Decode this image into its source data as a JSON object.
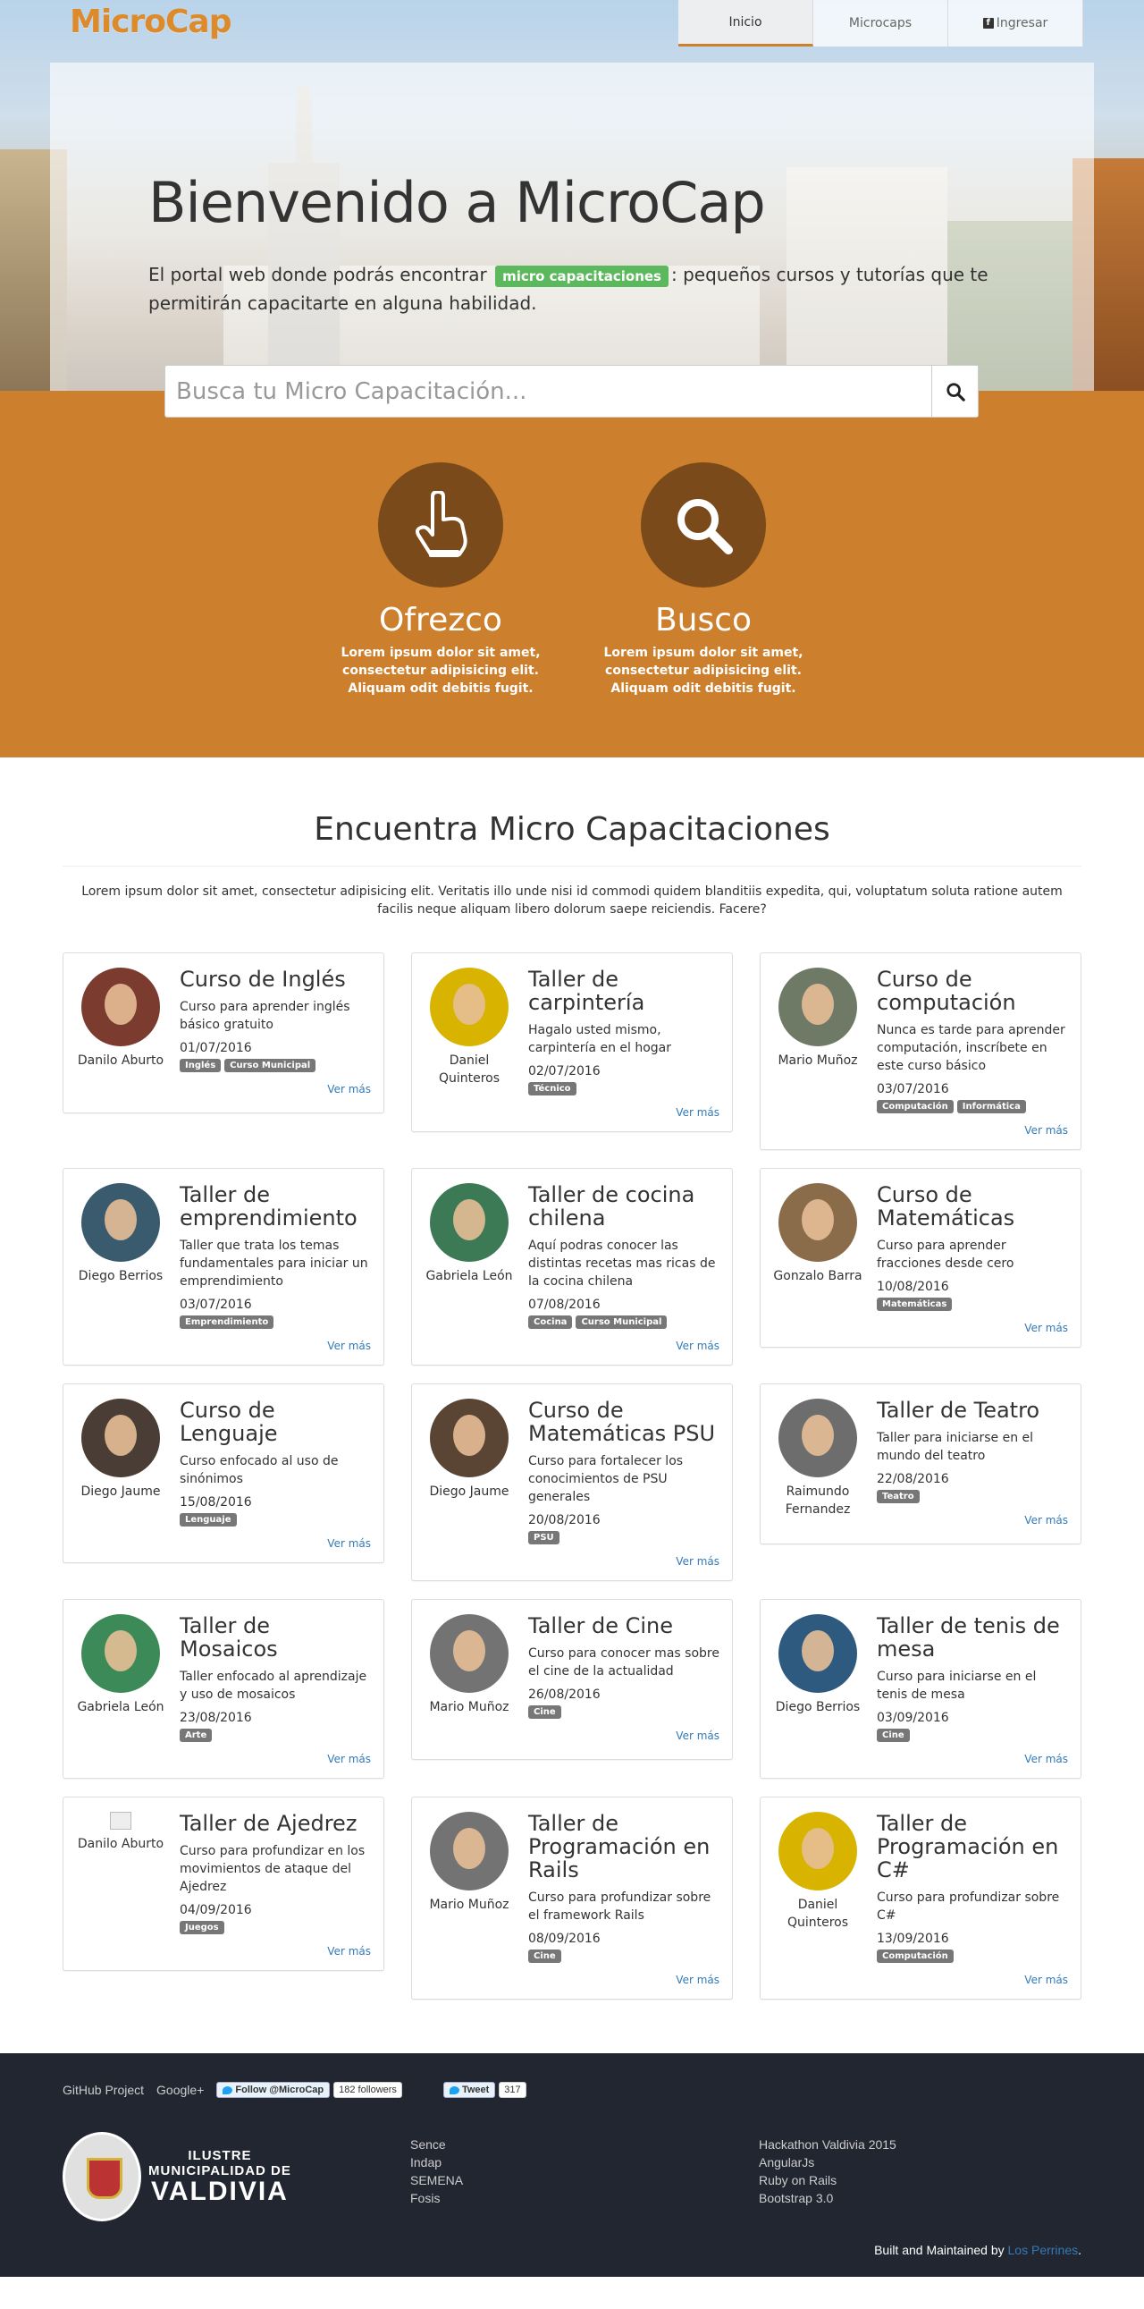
{
  "brand": "MicroCap",
  "nav": {
    "items": [
      {
        "label": "Inicio",
        "active": true
      },
      {
        "label": "Microcaps",
        "active": false
      },
      {
        "label": "Ingresar",
        "active": false,
        "icon": "facebook-icon"
      }
    ]
  },
  "hero": {
    "title": "Bienvenido a MicroCap",
    "text_before": "El portal web donde podrás encontrar",
    "highlight": "micro capacitaciones",
    "text_after": ": pequeños cursos y tutorías que te permitirán capacitarte en alguna habilidad."
  },
  "search": {
    "placeholder": "Busca tu Micro Capacitación...",
    "icon": "search-icon"
  },
  "features": [
    {
      "icon": "hand-pointer-icon",
      "title": "Ofrezco",
      "text": "Lorem ipsum dolor sit amet, consectetur adipisicing elit. Aliquam odit debitis fugit."
    },
    {
      "icon": "search-icon",
      "title": "Busco",
      "text": "Lorem ipsum dolor sit amet, consectetur adipisicing elit. Aliquam odit debitis fugit."
    }
  ],
  "section": {
    "title": "Encuentra Micro Capacitaciones",
    "lead": "Lorem ipsum dolor sit amet, consectetur adipisicing elit. Veritatis illo unde nisi id commodi quidem blanditiis expedita, qui, voluptatum soluta ratione autem facilis neque aliquam libero dolorum saepe reiciendis. Facere?"
  },
  "more_label": "Ver más",
  "cards": [
    {
      "author": "Danilo Aburto",
      "title": "Curso de Inglés",
      "desc": "Curso para aprender inglés básico gratuito",
      "date": "01/07/2016",
      "tags": [
        "Inglés",
        "Curso Municipal"
      ]
    },
    {
      "author": "Daniel Quinteros",
      "title": "Taller de carpintería",
      "desc": "Hagalo usted mismo, carpintería en el hogar",
      "date": "02/07/2016",
      "tags": [
        "Técnico"
      ]
    },
    {
      "author": "Mario Muñoz",
      "title": "Curso de computación",
      "desc": "Nunca es tarde para aprender computación, inscríbete en este curso básico",
      "date": "03/07/2016",
      "tags": [
        "Computación",
        "Informática"
      ]
    },
    {
      "author": "Diego Berrios",
      "title": "Taller de emprendimiento",
      "desc": "Taller que trata los temas fundamentales para iniciar un emprendimiento",
      "date": "03/07/2016",
      "tags": [
        "Emprendimiento"
      ]
    },
    {
      "author": "Gabriela León",
      "title": "Taller de cocina chilena",
      "desc": "Aquí podras conocer las distintas recetas mas ricas de la cocina chilena",
      "date": "07/08/2016",
      "tags": [
        "Cocina",
        "Curso Municipal"
      ]
    },
    {
      "author": "Gonzalo Barra",
      "title": "Curso de Matemáticas",
      "desc": "Curso para aprender fracciones desde cero",
      "date": "10/08/2016",
      "tags": [
        "Matemáticas"
      ]
    },
    {
      "author": "Diego Jaume",
      "title": "Curso de Lenguaje",
      "desc": "Curso enfocado al uso de sinónimos",
      "date": "15/08/2016",
      "tags": [
        "Lenguaje"
      ]
    },
    {
      "author": "Diego Jaume",
      "title": "Curso de Matemáticas PSU",
      "desc": "Curso para fortalecer los conocimientos de PSU generales",
      "date": "20/08/2016",
      "tags": [
        "PSU"
      ]
    },
    {
      "author": "Raimundo Fernandez",
      "title": "Taller de Teatro",
      "desc": "Taller para iniciarse en el mundo del teatro",
      "date": "22/08/2016",
      "tags": [
        "Teatro"
      ]
    },
    {
      "author": "Gabriela León",
      "title": "Taller de Mosaicos",
      "desc": "Taller enfocado al aprendizaje y uso de mosaicos",
      "date": "23/08/2016",
      "tags": [
        "Arte"
      ]
    },
    {
      "author": "Mario Muñoz",
      "title": "Taller de Cine",
      "desc": "Curso para conocer mas sobre el cine de la actualidad",
      "date": "26/08/2016",
      "tags": [
        "Cine"
      ]
    },
    {
      "author": "Diego Berrios",
      "title": "Taller de tenis de mesa",
      "desc": "Curso para iniciarse en el tenis de mesa",
      "date": "03/09/2016",
      "tags": [
        "Cine"
      ]
    },
    {
      "author": "Danilo Aburto",
      "title": "Taller de Ajedrez",
      "desc": "Curso para profundizar en los movimientos de ataque del Ajedrez",
      "date": "04/09/2016",
      "tags": [
        "Juegos"
      ]
    },
    {
      "author": "Mario Muñoz",
      "title": "Taller de Programación en Rails",
      "desc": "Curso para profundizar sobre el framework Rails",
      "date": "08/09/2016",
      "tags": [
        "Cine"
      ]
    },
    {
      "author": "Daniel Quinteros",
      "title": "Taller de Programación en C#",
      "desc": "Curso para profundizar sobre C#",
      "date": "13/09/2016",
      "tags": [
        "Computación"
      ]
    }
  ],
  "footer": {
    "github": "GitHub Project",
    "google": "Google+",
    "follow": "Follow @MicroCap",
    "followers": "182 followers",
    "tweet": "Tweet",
    "tweets": "317",
    "muni_line1": "ILUSTRE",
    "muni_line2": "MUNICIPALIDAD DE",
    "muni_line3": "VALDIVIA",
    "col1": [
      "Sence",
      "Indap",
      "SEMENA",
      "Fosis"
    ],
    "col2": [
      "Hackathon Valdivia 2015",
      "AngularJs",
      "Ruby on Rails",
      "Bootstrap 3.0"
    ],
    "built": "Built and Maintained by",
    "built_link": "Los Perrines",
    "built_end": "."
  }
}
